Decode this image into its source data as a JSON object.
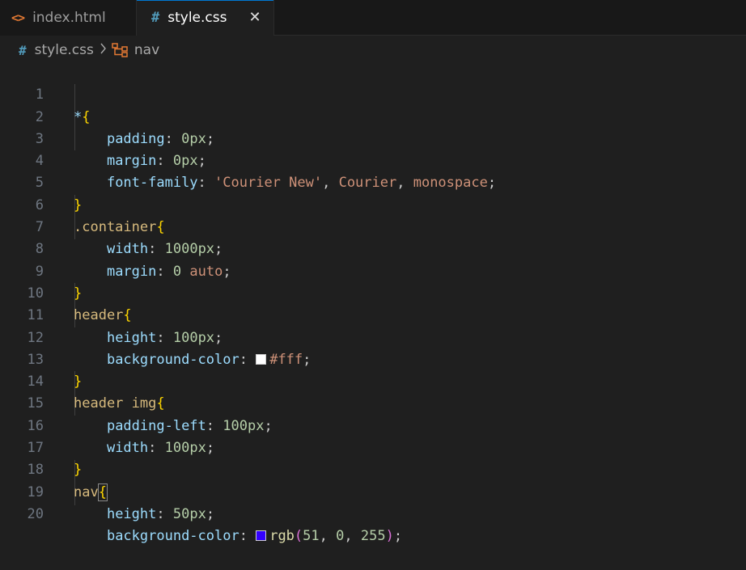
{
  "tabs": [
    {
      "label": "index.html",
      "icon": "html-icon",
      "active": false
    },
    {
      "label": "style.css",
      "icon": "hash-icon",
      "active": true
    }
  ],
  "close_glyph": "✕",
  "breadcrumb": {
    "file": "style.css",
    "symbol": "nav"
  },
  "lines": [
    {
      "n": "1"
    },
    {
      "n": "2"
    },
    {
      "n": "3"
    },
    {
      "n": "4"
    },
    {
      "n": "5"
    },
    {
      "n": "6"
    },
    {
      "n": "7"
    },
    {
      "n": "8"
    },
    {
      "n": "9"
    },
    {
      "n": "10"
    },
    {
      "n": "11"
    },
    {
      "n": "12"
    },
    {
      "n": "13"
    },
    {
      "n": "14"
    },
    {
      "n": "15"
    },
    {
      "n": "16"
    },
    {
      "n": "17"
    },
    {
      "n": "18"
    },
    {
      "n": "19"
    },
    {
      "n": "20"
    }
  ],
  "code": {
    "l1_sel": "*",
    "l1_open": "{",
    "l2_prop": "padding",
    "l2_val": "0px",
    "l3_prop": "margin",
    "l3_val": "0px",
    "l4_prop": "font-family",
    "l4_v1": "'Courier New'",
    "l4_v2": "Courier",
    "l4_v3": "monospace",
    "l5_close": "}",
    "l6_sel": ".container",
    "l6_open": "{",
    "l7_prop": "width",
    "l7_val": "1000px",
    "l8_prop": "margin",
    "l8_v1": "0",
    "l8_v2": "auto",
    "l9_close": "}",
    "l10_sel": "header",
    "l10_open": "{",
    "l11_prop": "height",
    "l11_val": "100px",
    "l12_prop": "background-color",
    "l12_val": "#fff",
    "l13_close": "}",
    "l14_sel": "header img",
    "l14_open": "{",
    "l15_prop": "padding-left",
    "l15_val": "100px",
    "l16_prop": "width",
    "l16_val": "100px",
    "l17_close": "}",
    "l18_sel": "nav",
    "l18_open": "{",
    "l19_prop": "height",
    "l19_val": "50px",
    "l20_prop": "background-color",
    "l20_fn": "rgb",
    "l20_p1": "(",
    "l20_a": "51",
    "l20_b": "0",
    "l20_c": "255",
    "l20_p2": ")"
  },
  "colors": {
    "swatch_white": "#ffffff",
    "swatch_blue": "#3300ff",
    "accent": "#0078d4"
  }
}
